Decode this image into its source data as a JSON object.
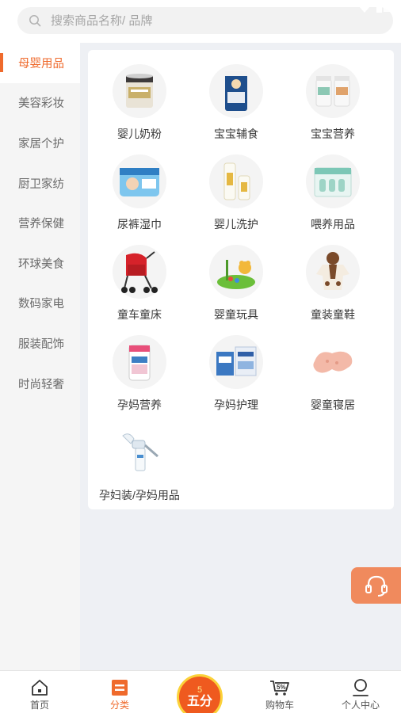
{
  "search": {
    "placeholder": "搜索商品名称/ 品牌"
  },
  "sidebar": {
    "items": [
      {
        "label": "母婴用品",
        "active": true
      },
      {
        "label": "美容彩妆"
      },
      {
        "label": "家居个护"
      },
      {
        "label": "厨卫家纺"
      },
      {
        "label": "营养保健"
      },
      {
        "label": "环球美食"
      },
      {
        "label": "数码家电"
      },
      {
        "label": "服装配饰"
      },
      {
        "label": "时尚轻奢"
      }
    ]
  },
  "grid": {
    "items": [
      {
        "label": "婴儿奶粉",
        "icon": "milk-powder-can-icon"
      },
      {
        "label": "宝宝辅食",
        "icon": "baby-food-can-icon"
      },
      {
        "label": "宝宝营养",
        "icon": "supplement-bottles-icon"
      },
      {
        "label": "尿裤湿巾",
        "icon": "diaper-pack-icon"
      },
      {
        "label": "婴儿洗护",
        "icon": "baby-wash-bottles-icon"
      },
      {
        "label": "喂养用品",
        "icon": "feeding-supplies-icon"
      },
      {
        "label": "童车童床",
        "icon": "stroller-icon"
      },
      {
        "label": "婴童玩具",
        "icon": "toy-icon"
      },
      {
        "label": "童装童鞋",
        "icon": "kids-clothing-icon"
      },
      {
        "label": "孕妈营养",
        "icon": "prenatal-vitamin-icon"
      },
      {
        "label": "孕妈护理",
        "icon": "maternity-care-icon"
      },
      {
        "label": "婴童寝居",
        "icon": "baby-pillow-icon"
      },
      {
        "label": "孕妇装/孕妈用品",
        "icon": "breast-pump-icon"
      }
    ]
  },
  "tabbar": {
    "home": "首页",
    "category": "分类",
    "center_number": "5",
    "center_label": "五分",
    "cart": "购物车",
    "profile": "个人中心"
  },
  "colors": {
    "accent": "#ef6a2c",
    "service": "#f08a5d"
  }
}
